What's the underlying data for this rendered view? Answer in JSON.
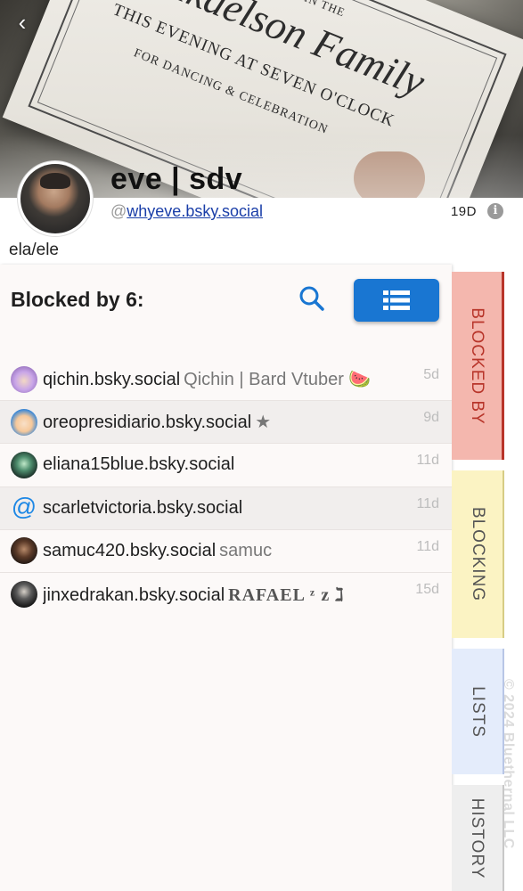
{
  "nav": {
    "back_glyph": "‹"
  },
  "banner": {
    "line1": "PLEASE JOIN THE",
    "line2": "Mikaelson Family",
    "line3": "THIS EVENING AT SEVEN O'CLOCK",
    "line4": "FOR DANCING & CELEBRATION"
  },
  "profile": {
    "display_name": "eve | sdv",
    "handle_prefix": "@",
    "handle": "whyeve.bsky.social",
    "age": "19D",
    "info_glyph": "i",
    "pronouns": "ela/ele"
  },
  "panel": {
    "title": "Blocked by 6:",
    "search_icon": "search-icon",
    "list_icon": "list-view-icon",
    "rows": [
      {
        "handle": "qichin.bsky.social",
        "name": "Qichin | Bard Vtuber 🍉",
        "time": "5d",
        "avatar": "qichin"
      },
      {
        "handle": "oreopresidiario.bsky.social",
        "name": "★",
        "time": "9d",
        "avatar": "oreo"
      },
      {
        "handle": "eliana15blue.bsky.social",
        "name": "",
        "time": "11d",
        "avatar": "eliana"
      },
      {
        "handle": "scarletvictoria.bsky.social",
        "name": "",
        "time": "11d",
        "avatar": "at"
      },
      {
        "handle": "samuc420.bsky.social",
        "name": "samuc",
        "time": "11d",
        "avatar": "samuc"
      },
      {
        "handle": "jinxedrakan.bsky.social",
        "name": "RAFAEL ᶻ z ℷ",
        "time": "15d",
        "avatar": "jinx"
      }
    ]
  },
  "tabs": {
    "blocked_by": "BLOCKED BY",
    "blocking": "BLOCKING",
    "lists": "LISTS",
    "history": "HISTORY"
  },
  "footer": {
    "copyright": "© 2024 Bluethernal LLC"
  },
  "colors": {
    "accent": "#1976d2",
    "blocked_tab": "#f4b7ae",
    "blocking_tab": "#fbf3c3",
    "lists_tab": "#e4ecfb"
  }
}
